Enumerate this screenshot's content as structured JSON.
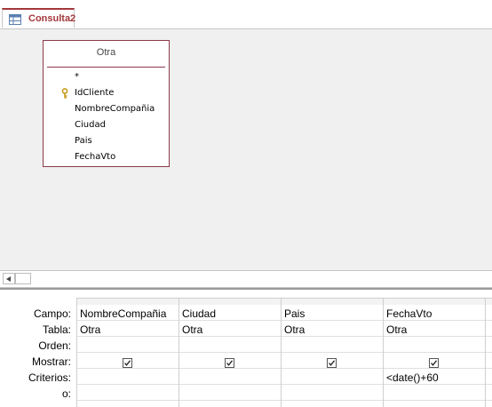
{
  "tab": {
    "label": "Consulta2",
    "icon": "query-design-icon"
  },
  "table": {
    "name": "Otra",
    "fields": [
      "*",
      "IdCliente",
      "NombreCompañia",
      "Ciudad",
      "Pais",
      "FechaVto"
    ],
    "primary_key_field": "IdCliente"
  },
  "grid": {
    "row_labels": {
      "campo": "Campo:",
      "tabla": "Tabla:",
      "orden": "Orden:",
      "mostrar": "Mostrar:",
      "criterios": "Criterios:",
      "o": "o:"
    },
    "columns": [
      {
        "campo": "NombreCompañia",
        "tabla": "Otra",
        "orden": "",
        "mostrar": true,
        "criterios": "",
        "o": ""
      },
      {
        "campo": "Ciudad",
        "tabla": "Otra",
        "orden": "",
        "mostrar": true,
        "criterios": "",
        "o": ""
      },
      {
        "campo": "Pais",
        "tabla": "Otra",
        "orden": "",
        "mostrar": true,
        "criterios": "",
        "o": ""
      },
      {
        "campo": "FechaVto",
        "tabla": "Otra",
        "orden": "",
        "mostrar": true,
        "criterios": "<date()+60",
        "o": ""
      }
    ]
  },
  "colors": {
    "accent": "#a4373a",
    "table_border": "#8b3a4a",
    "design_bg": "#f0f0f0"
  }
}
